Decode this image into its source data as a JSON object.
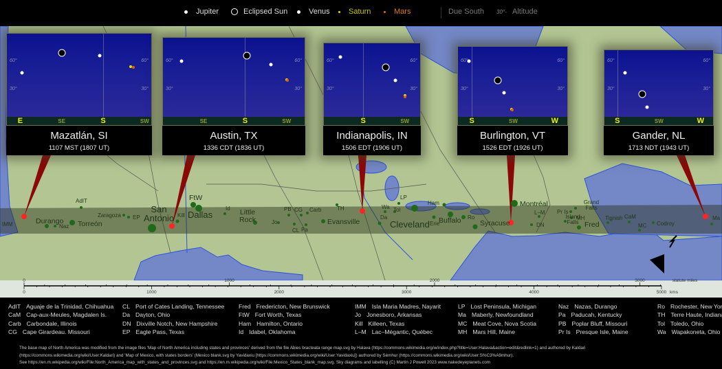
{
  "legend": {
    "items": [
      {
        "label": "Jupiter",
        "color": "#ffffff",
        "icon": "white-dot"
      },
      {
        "label": "Eclipsed Sun",
        "color": "#000000",
        "icon": "black-disc-white-ring"
      },
      {
        "label": "Venus",
        "color": "#ffffff",
        "icon": "white-dot"
      },
      {
        "label": "Saturn",
        "color": "#d8d000",
        "icon": "yellow-dot"
      },
      {
        "label": "Mars",
        "color": "#e07010",
        "icon": "orange-dot"
      }
    ],
    "due_south": "Due South",
    "altitude_sample": "30°-",
    "altitude": "Altitude"
  },
  "colors": {
    "land": "#b2c592",
    "water": "#7487c6",
    "path": "#5a6240",
    "pointer": "#8a0808",
    "point": "#ff2424"
  },
  "panels": [
    {
      "city": "Mazatlán, SI",
      "time": "1107 MST (1807 UT)",
      "az_range": [
        75.5,
        233.7
      ],
      "horizon": [
        {
          "label": "E",
          "az": 90,
          "major": true
        },
        {
          "label": "SE",
          "az": 135,
          "major": false
        },
        {
          "label": "S",
          "az": 180,
          "major": true
        },
        {
          "label": "SW",
          "az": 225,
          "major": false
        }
      ],
      "objects": [
        {
          "body": "Sun",
          "az": 135,
          "alt": 70
        },
        {
          "body": "Jupiter",
          "az": 92,
          "alt": 48
        },
        {
          "body": "Venus",
          "az": 176,
          "alt": 67
        },
        {
          "body": "Saturn",
          "az": 210,
          "alt": 55
        },
        {
          "body": "Mars",
          "az": 213,
          "alt": 54
        }
      ]
    },
    {
      "city": "Austin, TX",
      "time": "1336 CDT (1836 UT)",
      "az_range": [
        91,
        246
      ],
      "horizon": [
        {
          "label": "SE",
          "az": 135,
          "major": false
        },
        {
          "label": "S",
          "az": 180,
          "major": true
        },
        {
          "label": "SW",
          "az": 225,
          "major": false
        }
      ],
      "objects": [
        {
          "body": "Sun",
          "az": 182,
          "alt": 67
        },
        {
          "body": "Jupiter",
          "az": 111,
          "alt": 61
        },
        {
          "body": "Venus",
          "az": 208,
          "alt": 57
        },
        {
          "body": "Saturn",
          "az": 225,
          "alt": 41
        },
        {
          "body": "Mars",
          "az": 226,
          "alt": 40
        }
      ]
    },
    {
      "city": "Indianapolis, IN",
      "time": "1506 EDT (1906 UT)",
      "az_range": [
        137.5,
        243
      ],
      "horizon": [
        {
          "label": "S",
          "az": 180,
          "major": true
        },
        {
          "label": "SW",
          "az": 225,
          "major": false
        }
      ],
      "objects": [
        {
          "body": "Sun",
          "az": 204,
          "alt": 54
        },
        {
          "body": "Jupiter",
          "az": 155,
          "alt": 65
        },
        {
          "body": "Venus",
          "az": 215,
          "alt": 40
        },
        {
          "body": "Saturn",
          "az": 225,
          "alt": 24
        },
        {
          "body": "Mars",
          "az": 225.5,
          "alt": 22
        }
      ]
    },
    {
      "city": "Burlington, VT",
      "time": "1526 EDT (1926 UT)",
      "az_range": [
        165,
        285
      ],
      "horizon": [
        {
          "label": "S",
          "az": 180,
          "major": true
        },
        {
          "label": "SW",
          "az": 225,
          "major": false
        },
        {
          "label": "W",
          "az": 270,
          "major": true
        }
      ],
      "objects": [
        {
          "body": "Sun",
          "az": 208,
          "alt": 40
        },
        {
          "body": "Jupiter",
          "az": 177,
          "alt": 61
        },
        {
          "body": "Venus",
          "az": 215,
          "alt": 27
        },
        {
          "body": "Saturn",
          "az": 223,
          "alt": 9
        },
        {
          "body": "Mars",
          "az": 224,
          "alt": 8
        }
      ]
    },
    {
      "city": "Gander, NL",
      "time": "1713 NDT (1943 UT)",
      "az_range": [
        166,
        285
      ],
      "horizon": [
        {
          "label": "S",
          "az": 180,
          "major": true
        },
        {
          "label": "SW",
          "az": 225,
          "major": false
        },
        {
          "label": "W",
          "az": 270,
          "major": true
        }
      ],
      "objects": [
        {
          "body": "Sun",
          "az": 207,
          "alt": 25
        },
        {
          "body": "Jupiter",
          "az": 188,
          "alt": 48
        },
        {
          "body": "Venus",
          "az": 212,
          "alt": 11
        }
      ]
    }
  ],
  "altitude_ticks": [
    "60°",
    "30°"
  ],
  "map_labels": {
    "IMM": "IMM",
    "Durango": "Durango",
    "Naz": "Naz",
    "AdIT": "AdIT",
    "Torreon": "Torreón",
    "Zaragoza": "Zaragoza",
    "EP": "EP",
    "SanAntonio": "San Antonio",
    "Kill": "Kill",
    "FtW": "FtW",
    "Dallas": "Dallas",
    "Id": "Id",
    "LittleRock": "Little Rock",
    "Jo": "Jo",
    "PB": "PB",
    "CG": "CG",
    "Carb": "Carb",
    "CL": "CL",
    "Pa": "Pa",
    "TH": "TH",
    "Evansville": "Evansville",
    "LP": "LP",
    "Wa": "Wa",
    "Tol": "Tol",
    "Da": "Da",
    "Cleveland": "Cleveland",
    "Erie": "Erie",
    "Ham": "Ham",
    "Buffalo": "Buffalo",
    "Ro": "Ro",
    "Syracuse": "Syracuse",
    "Montreal": "Montréal",
    "LM": "L–M",
    "DN": "DN",
    "PrIs": "Pr Is",
    "IslandFalls": "Island Falls",
    "GrandFalls": "Grand Falls",
    "MH": "MH",
    "Fred": "Fred",
    "Tignish": "Tignish",
    "CaM": "CaM",
    "MC": "MC",
    "Codroy": "Codroy",
    "Ma": "Ma"
  },
  "scale": {
    "miles_label": "statute miles",
    "miles_ticks": [
      "0",
      "1000",
      "2000",
      "3000"
    ],
    "km_label": "kms",
    "km_ticks": [
      "0",
      "1000",
      "2000",
      "3000",
      "4000",
      "5000"
    ]
  },
  "abbreviations": [
    [
      [
        "AdIT",
        "Aguaje de la Trinidad, Chihuahua"
      ],
      [
        "CaM",
        "Cap-aux-Meules, Magdalen Is."
      ],
      [
        "Carb",
        "Carbondale, Illinois"
      ],
      [
        "CG",
        "Cape Girardeau. Missouri"
      ]
    ],
    [
      [
        "CL",
        "Port of Cates Landing, Tennessee"
      ],
      [
        "Da",
        "Dayton, Ohio"
      ],
      [
        "DN",
        "Dixville Notch, New Hampshire"
      ],
      [
        "EP",
        "Eagle Pass, Texas"
      ]
    ],
    [
      [
        "Fred",
        "Fredericton, New Brunswick"
      ],
      [
        "FtW",
        "Fort Worth, Texas"
      ],
      [
        "Ham",
        "Hamilton, Ontario"
      ],
      [
        "Id",
        "Idabel, Oklahoma"
      ]
    ],
    [
      [
        "IMM",
        "Isla Maria Madres, Nayarit"
      ],
      [
        "Jo",
        "Jonesboro, Arkansas"
      ],
      [
        "Kill",
        "Killeen, Texas"
      ],
      [
        "L–M",
        "Lac–Mégantic, Québec"
      ]
    ],
    [
      [
        "LP",
        "Lost Peninsula, Michigan"
      ],
      [
        "Ma",
        "Maberly, Newfoundland"
      ],
      [
        "MC",
        "Meat Cove, Nova Scotia"
      ],
      [
        "MH",
        "Mars Hill, Maine"
      ]
    ],
    [
      [
        "Naz",
        "Nazas, Durango"
      ],
      [
        "Pa",
        "Paducah, Kentucky"
      ],
      [
        "PB",
        "Poplar Bluff, Missouri"
      ],
      [
        "Pr Is",
        "Presque Isle, Maine"
      ]
    ],
    [
      [
        "Ro",
        "Rochester, New York"
      ],
      [
        "TH",
        "Terre Haute, Indiana"
      ],
      [
        "Tol",
        "Toledo, Ohio"
      ],
      [
        "Wa",
        "Wapakoneta, Ohio"
      ]
    ]
  ],
  "credits": [
    "The base map of North America was modified from the image files 'Map of North America including states and provinces' derived from the file Abies bracteata range map.svg by Halava (https://commons.wikimedia.org/w/index.php?title=User:Halava&action=edit&redlink=1) and authored by Kaldari",
    "(https://commons.wikimedia.org/wiki/User:Kaldari) and 'Map of Mexico, with states borders' (Mexico blank.svg by Yavidaxiu [https://commons.wikimedia.org/wiki/User:Yavidaxiu]) authored by Sémhur (https://commons.wikimedia.org/wiki/User:S%C3%A9mhur).",
    "See  https://en.m.wikipedia.org/wiki/File:North_America_map_with_states_and_provinces.svg and https://en.m.wikipedia.org/wiki/File:Mexico_States_blank_map.svg.  Sky diagrams and labelling (C) Martin J Powell  2023  www.nakedeyeplanets.com"
  ]
}
